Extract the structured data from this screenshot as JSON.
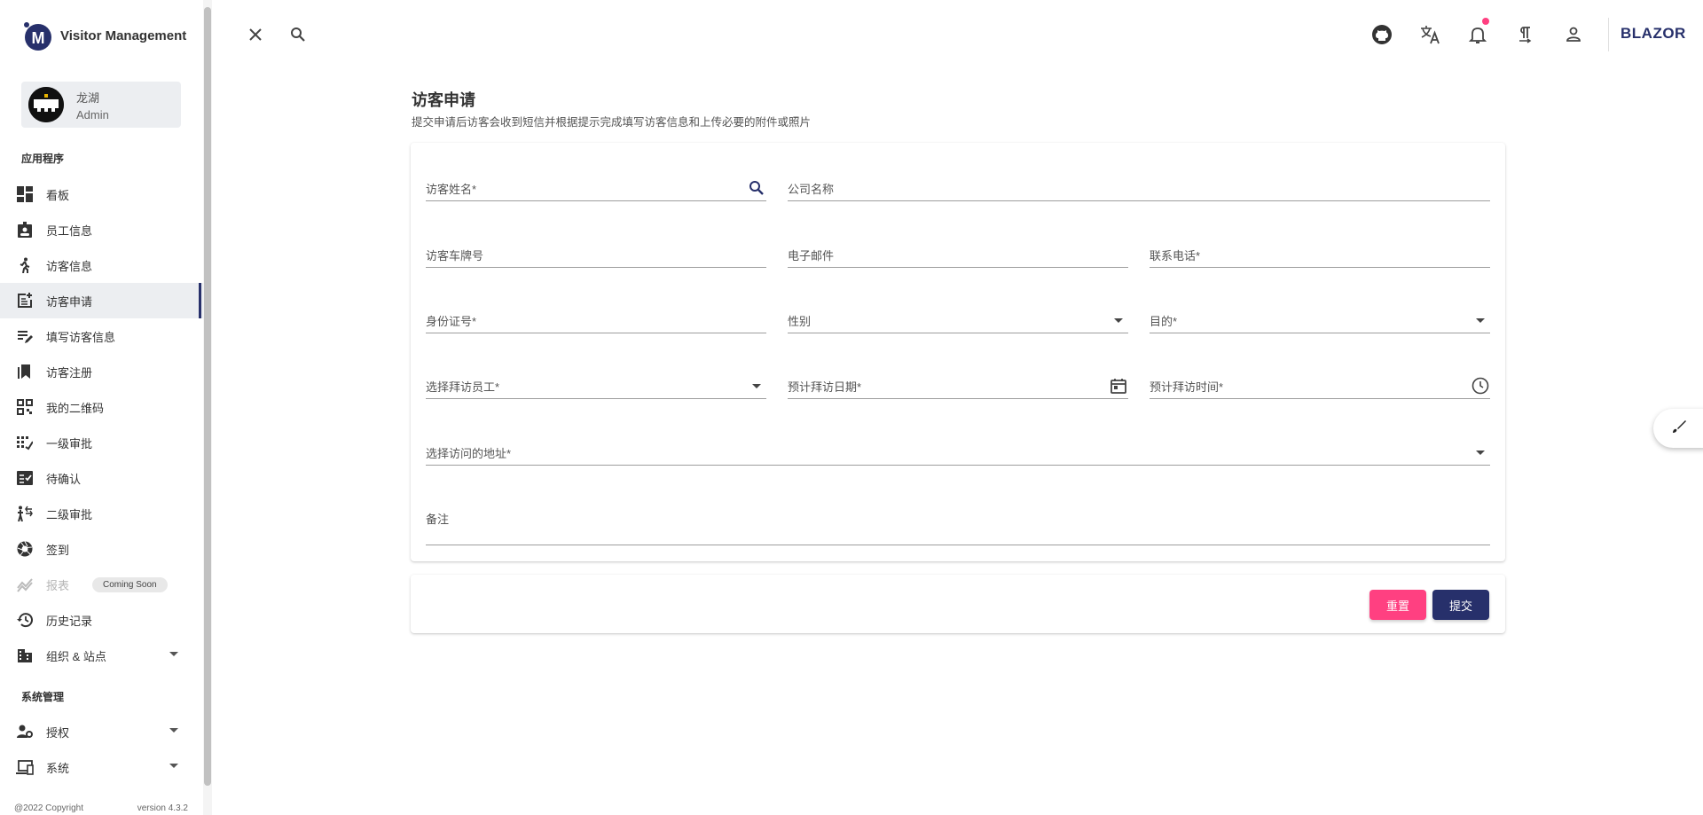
{
  "app": {
    "title": "Visitor Management"
  },
  "user": {
    "name": "龙湖",
    "role": "Admin"
  },
  "sidebar": {
    "section_apps": "应用程序",
    "items": [
      {
        "label": "看板",
        "icon": "dashboard-icon"
      },
      {
        "label": "员工信息",
        "icon": "badge-icon"
      },
      {
        "label": "访客信息",
        "icon": "walk-icon"
      },
      {
        "label": "访客申请",
        "icon": "post-add-icon",
        "active": true
      },
      {
        "label": "填写访客信息",
        "icon": "edit-note-icon"
      },
      {
        "label": "访客注册",
        "icon": "bookmarks-icon"
      },
      {
        "label": "我的二维码",
        "icon": "qr-code-icon"
      },
      {
        "label": "一级审批",
        "icon": "pin-icon"
      },
      {
        "label": "待确认",
        "icon": "fact-check-icon"
      },
      {
        "label": "二级审批",
        "icon": "transfer-icon"
      },
      {
        "label": "签到",
        "icon": "camera-icon"
      },
      {
        "label": "报表",
        "icon": "chart-icon",
        "disabled": true,
        "chip": "Coming Soon"
      },
      {
        "label": "历史记录",
        "icon": "history-icon"
      },
      {
        "label": "组织 & 站点",
        "icon": "business-icon"
      }
    ],
    "section_system": "系统管理",
    "system_items": [
      {
        "label": "授权",
        "icon": "manage-accounts-icon"
      },
      {
        "label": "系统",
        "icon": "devices-icon"
      }
    ],
    "copyright": "@2022 Copyright",
    "version": "version 4.3.2"
  },
  "topbar": {
    "icons": [
      "close-icon",
      "search-icon",
      "github-icon",
      "translate-icon",
      "notifications-icon",
      "text-direction-icon",
      "account-icon"
    ],
    "brand": "BLAZOR",
    "accent": "#27306b",
    "badge_color": "#ff4081"
  },
  "page": {
    "title": "访客申请",
    "subtitle": "提交申请后访客会收到短信并根据提示完成填写访客信息和上传必要的附件或照片"
  },
  "form": {
    "visitor_name": "访客姓名*",
    "company": "公司名称",
    "plate": "访客车牌号",
    "email": "电子邮件",
    "phone": "联系电话*",
    "id_number": "身份证号*",
    "gender": "性别",
    "purpose": "目的*",
    "employee": "选择拜访员工*",
    "visit_date": "预计拜访日期*",
    "visit_time": "预计拜访时间*",
    "address": "选择访问的地址*",
    "remark": "备注"
  },
  "actions": {
    "reset": "重置",
    "submit": "提交"
  }
}
